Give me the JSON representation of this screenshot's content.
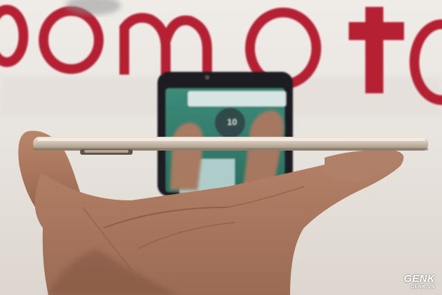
{
  "scene": {
    "description_free": true,
    "backdrop_wordmark": "moto",
    "backdrop_color": "#e8e4df",
    "wordmark_color": "#b0142a",
    "phone_body_color": "#cdbfae",
    "skin_color": "#a8765a"
  },
  "screen": {
    "clock_text": "10"
  },
  "watermark": {
    "brand": "GENK",
    "site": "GENK.VN"
  }
}
